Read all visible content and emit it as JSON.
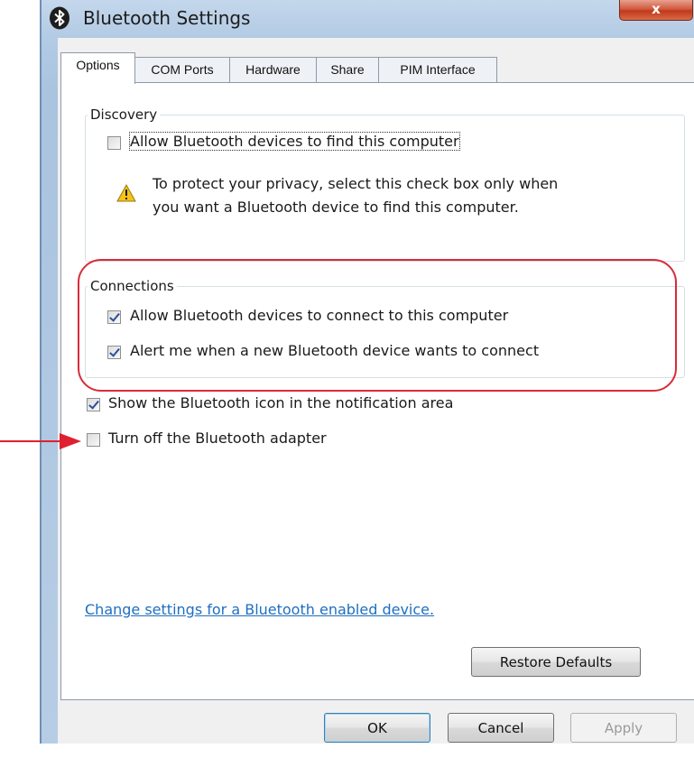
{
  "window": {
    "title": "Bluetooth Settings",
    "close_label": "x"
  },
  "tabs": [
    {
      "label": "Options",
      "active": true
    },
    {
      "label": "COM Ports",
      "active": false
    },
    {
      "label": "Hardware",
      "active": false
    },
    {
      "label": "Share",
      "active": false
    },
    {
      "label": "PIM Interface",
      "active": false
    }
  ],
  "discovery": {
    "group_label": "Discovery",
    "allow_find": {
      "label": "Allow Bluetooth devices to find this computer",
      "checked": false
    },
    "warning": {
      "line1": "To protect your privacy, select this check box only when",
      "line2": "you want a Bluetooth device to find this computer."
    }
  },
  "connections": {
    "group_label": "Connections",
    "allow_connect": {
      "label": "Allow Bluetooth devices to connect to this computer",
      "checked": true
    },
    "alert_new": {
      "label": "Alert me when a new Bluetooth device wants to connect",
      "checked": true
    }
  },
  "options": {
    "show_icon": {
      "label": "Show the Bluetooth icon in the notification area",
      "checked": true
    },
    "turn_off": {
      "label": "Turn off the Bluetooth adapter",
      "checked": false
    }
  },
  "link_text": "Change settings for a Bluetooth enabled device.",
  "buttons": {
    "restore": "Restore Defaults",
    "ok": "OK",
    "cancel": "Cancel",
    "apply": "Apply"
  },
  "colors": {
    "highlight": "#d92b3a",
    "arrow": "#e0202f",
    "link": "#1e6fc1"
  },
  "icons": [
    "bluetooth-icon",
    "close-icon",
    "warning-icon",
    "arrow-pointer-icon"
  ]
}
